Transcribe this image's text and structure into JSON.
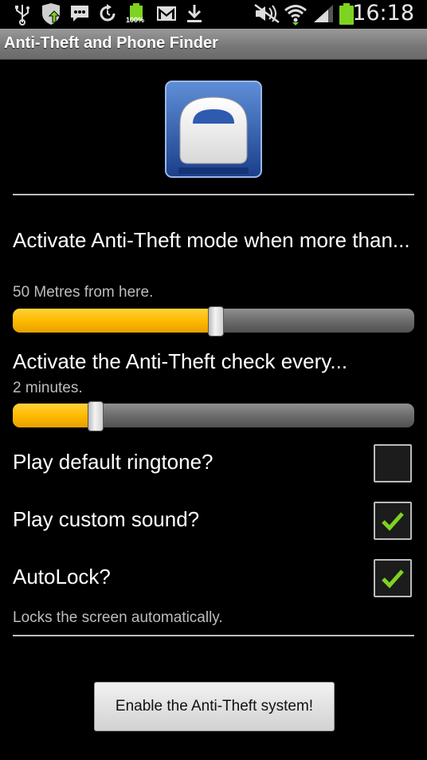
{
  "status_bar": {
    "time": "16:18",
    "battery_percent": "100%",
    "icons": [
      "usb-icon",
      "shield-update-icon",
      "message-icon",
      "sync-icon",
      "battery-full-icon",
      "gmail-icon",
      "download-icon",
      "mute-icon",
      "wifi-icon",
      "signal-icon",
      "battery-icon"
    ]
  },
  "title_bar": {
    "title": "Anti-Theft and Phone Finder"
  },
  "app_icon": "padlock-icon",
  "distance": {
    "label": "Activate Anti-Theft mode when more than...",
    "summary": "50 Metres from here.",
    "slider_level": 0.5
  },
  "interval": {
    "label": "Activate the Anti-Theft check every...",
    "summary": "2 minutes.",
    "slider_level": 0.2
  },
  "options": {
    "ringtone": {
      "label": "Play default ringtone?",
      "checked": false
    },
    "custom_sound": {
      "label": "Play custom sound?",
      "checked": true
    },
    "autolock": {
      "label": "AutoLock?",
      "checked": true,
      "summary": "Locks the screen automatically."
    }
  },
  "enable_button": "Enable the Anti-Theft system!",
  "colors": {
    "accent": "#ffba00",
    "check_green": "#7ed321"
  }
}
